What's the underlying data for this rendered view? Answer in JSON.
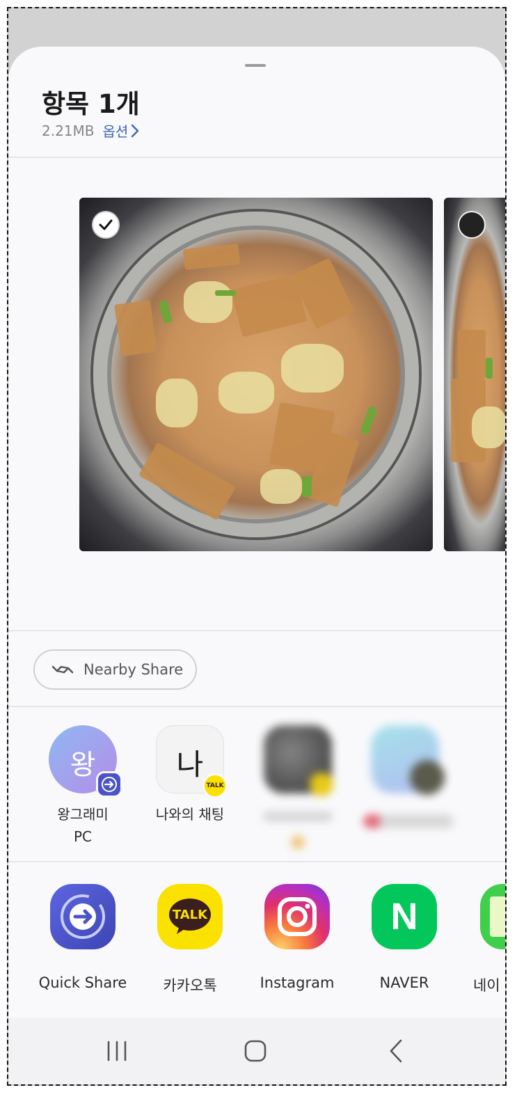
{
  "sheet": {
    "title": "항목 1개",
    "file_size": "2.21MB",
    "options_label": "옵션",
    "options_chevron": "chevron-right-icon"
  },
  "preview": {
    "items": [
      {
        "selected": true,
        "check_icon": "checkmark-icon"
      },
      {
        "selected": false,
        "check_icon": "circle-icon"
      }
    ]
  },
  "nearby_share": {
    "label": "Nearby Share",
    "icon": "nearby-share-icon"
  },
  "direct_share": [
    {
      "label_line1": "왕그래미",
      "label_line2": "PC",
      "avatar_text": "왕",
      "badge_icon": "quick-share-badge-icon"
    },
    {
      "label_line1": "나와의 채팅",
      "label_line2": "",
      "avatar_text": "나",
      "badge_icon": "kakaotalk-badge-icon",
      "badge_text": "TALK"
    },
    {
      "label_line1": "",
      "label_line2": "",
      "blurred": true
    },
    {
      "label_line1": "",
      "label_line2": "",
      "blurred": true
    }
  ],
  "apps": [
    {
      "label": "Quick Share",
      "icon": "quick-share-icon",
      "color": "#4b53c9"
    },
    {
      "label": "카카오톡",
      "icon": "kakaotalk-icon",
      "color": "#fae100",
      "icon_text": "TALK"
    },
    {
      "label": "Instagram",
      "icon": "instagram-icon",
      "color": "#e1306c"
    },
    {
      "label": "NAVER",
      "icon": "naver-icon",
      "color": "#03c75a",
      "icon_text": "N"
    },
    {
      "label": "네이",
      "icon": "naver-memo-icon",
      "color": "#3fcf4a"
    }
  ],
  "nav": {
    "recent": "recent-apps-icon",
    "home": "home-icon",
    "back": "back-icon"
  }
}
